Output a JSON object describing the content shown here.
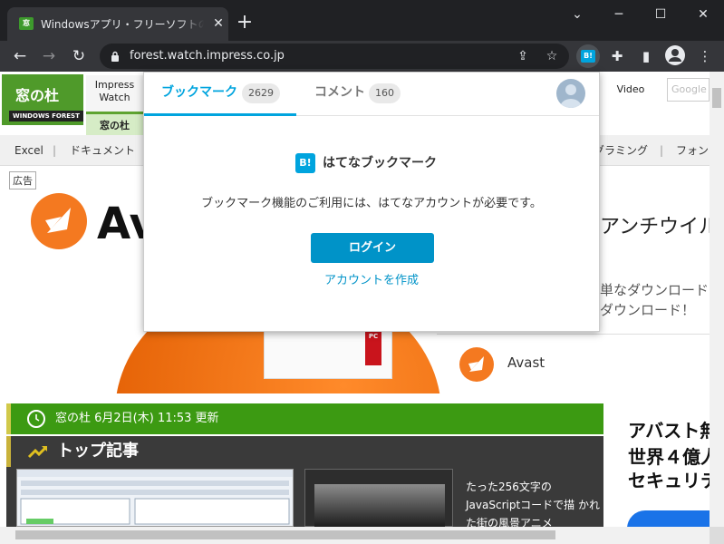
{
  "browser": {
    "tab_title": "Windowsアプリ・フリーソフトのおすすめ",
    "tab_favicon_text": "窓",
    "new_tab_glyph": "+",
    "tab_close_glyph": "✕",
    "window_controls": {
      "minimize": "─",
      "maximize": "☐",
      "close": "✕",
      "tabsearch": "⌄"
    },
    "url": "forest.watch.impress.co.jp",
    "nav": {
      "back": "←",
      "forward": "→",
      "reload": "↻"
    },
    "extension_label": "B!"
  },
  "site": {
    "logo_kanji": "窓の杜",
    "logo_sub": "WINDOWS FOREST",
    "nav_impress": "Impress Watch",
    "nav_madonomori": "窓の杜",
    "nav_video": "Video",
    "search_placeholder": "Google",
    "categories": [
      "Excel",
      "|",
      "ドキュメント",
      "グラミング",
      "|",
      "フォン"
    ]
  },
  "ad": {
    "label": "広告",
    "brand_word": "Ava",
    "headline": "アンチウイル",
    "line1": "単なダウンロード",
    "line2": "ダウンロード！",
    "pc_badge": "PC",
    "advertiser": "Avast"
  },
  "content": {
    "update_text": "窓の杜 6月2日(木) 11:53 更新",
    "top_section_title": "トップ記事",
    "article_text": "たった256文字の JavaScriptコードで描 かれた街の風景アニメ"
  },
  "side_ad": {
    "title": "アバスト無",
    "subtitle_line1": "世界４億人",
    "subtitle_line2": "セキュリテ"
  },
  "popup": {
    "tab_bookmark": "ブックマーク",
    "bookmark_count": "2629",
    "tab_comment": "コメント",
    "comment_count": "160",
    "brand_icon": "B!",
    "brand_name": "はてなブックマーク",
    "message": "ブックマーク機能のご利用には、はてなアカウントが必要です。",
    "login_label": "ログイン",
    "create_account_label": "アカウントを作成"
  },
  "colors": {
    "hatena_blue": "#00a4de",
    "login_blue": "#0093c8",
    "forest_green": "#3c9a12",
    "avast_orange": "#f47920"
  }
}
